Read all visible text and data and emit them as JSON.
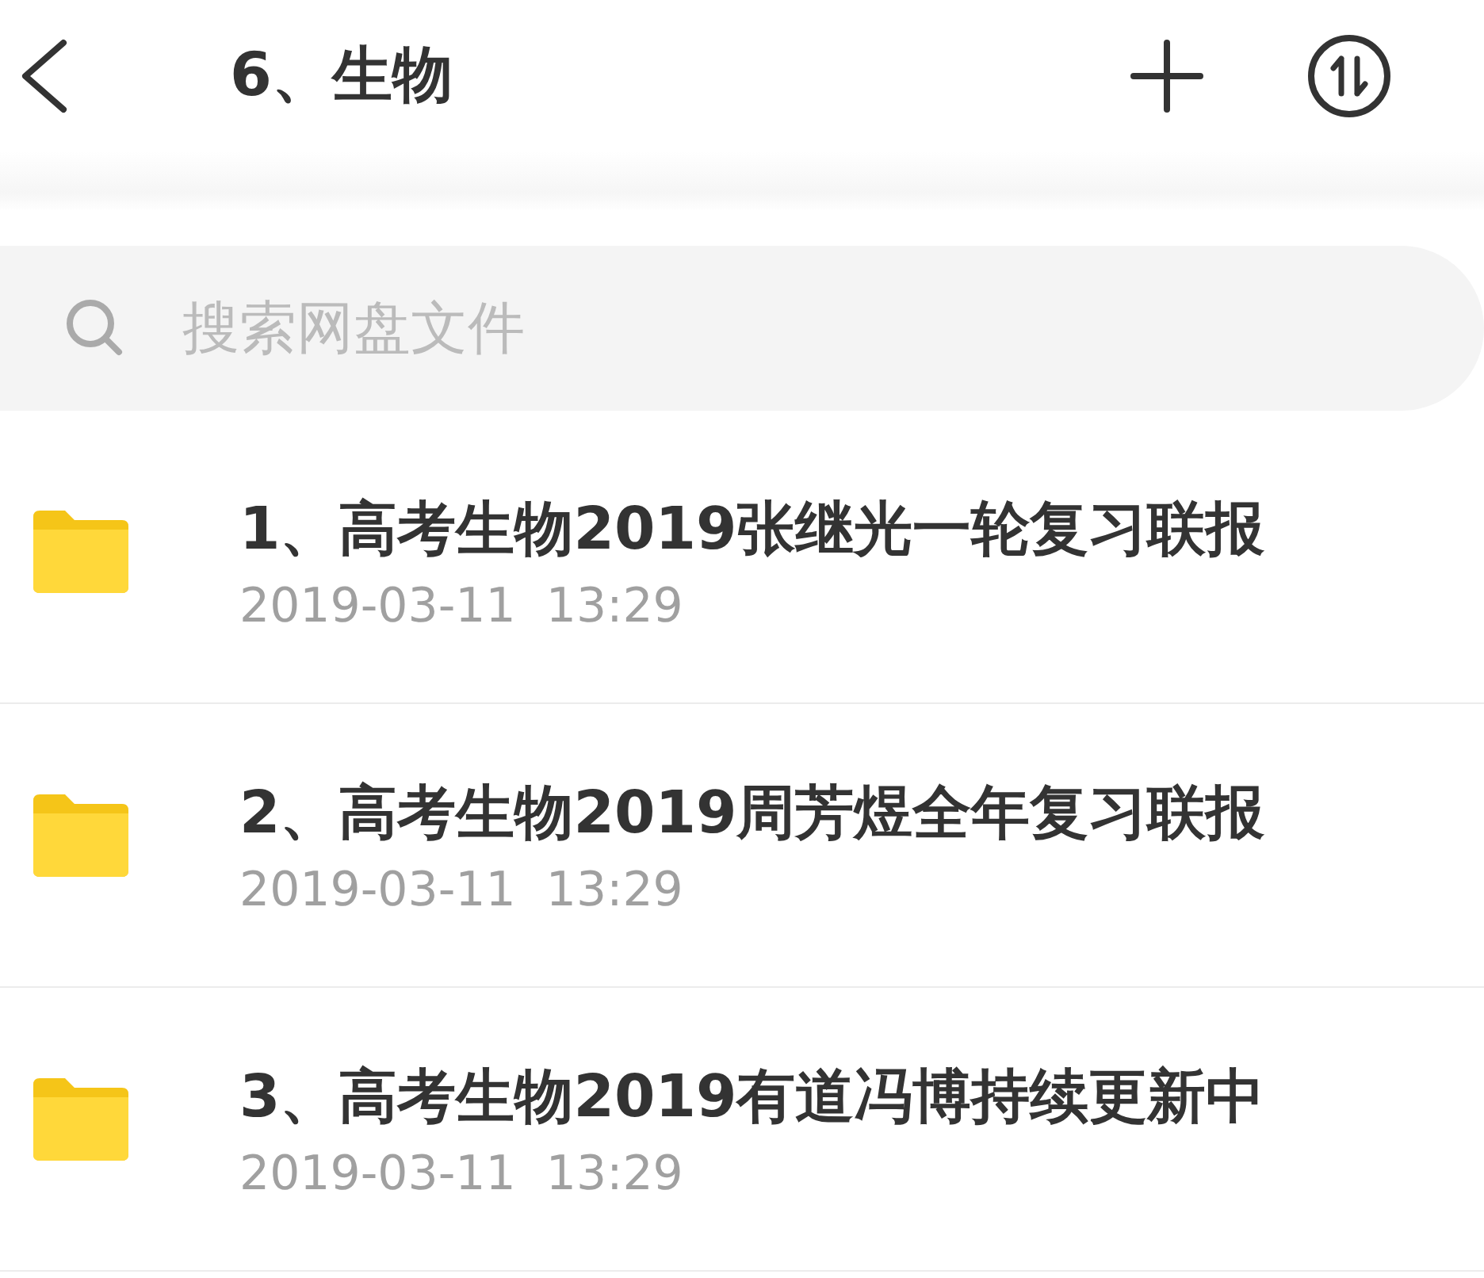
{
  "header": {
    "title": "6、生物"
  },
  "search": {
    "placeholder": "搜索网盘文件"
  },
  "files": [
    {
      "name": "1、高考生物2019张继光一轮复习联报",
      "modified": "2019-03-11  13:29"
    },
    {
      "name": "2、高考生物2019周芳煜全年复习联报",
      "modified": "2019-03-11  13:29"
    },
    {
      "name": "3、高考生物2019有道冯博持续更新中",
      "modified": "2019-03-11  13:29"
    }
  ]
}
